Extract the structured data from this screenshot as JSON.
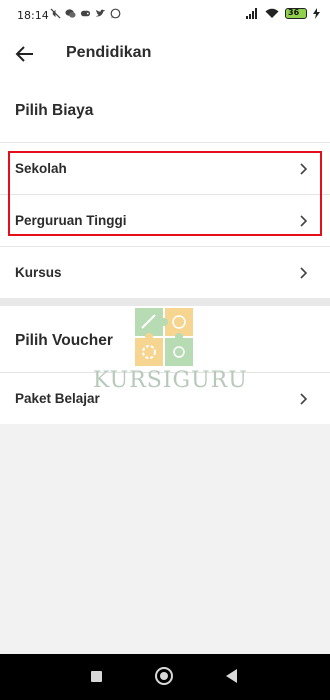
{
  "status_bar": {
    "time": "18:14",
    "left_icons": [
      "mute-icon",
      "chat-icon",
      "gamepad-icon",
      "twitter-icon",
      "whatsapp-icon"
    ],
    "battery_level": "36",
    "charging": true
  },
  "header": {
    "title": "Pendidikan"
  },
  "pilih_biaya": {
    "title": "Pilih Biaya",
    "items": [
      {
        "label": "Sekolah"
      },
      {
        "label": "Perguruan Tinggi"
      },
      {
        "label": "Kursus"
      }
    ]
  },
  "pilih_voucher": {
    "title": "Pilih Voucher",
    "items": [
      {
        "label": "Paket Belajar"
      }
    ]
  },
  "watermark": {
    "text": "KURSIGURU"
  },
  "colors": {
    "highlight": "#e3101c",
    "background": "#f2f2f2"
  }
}
